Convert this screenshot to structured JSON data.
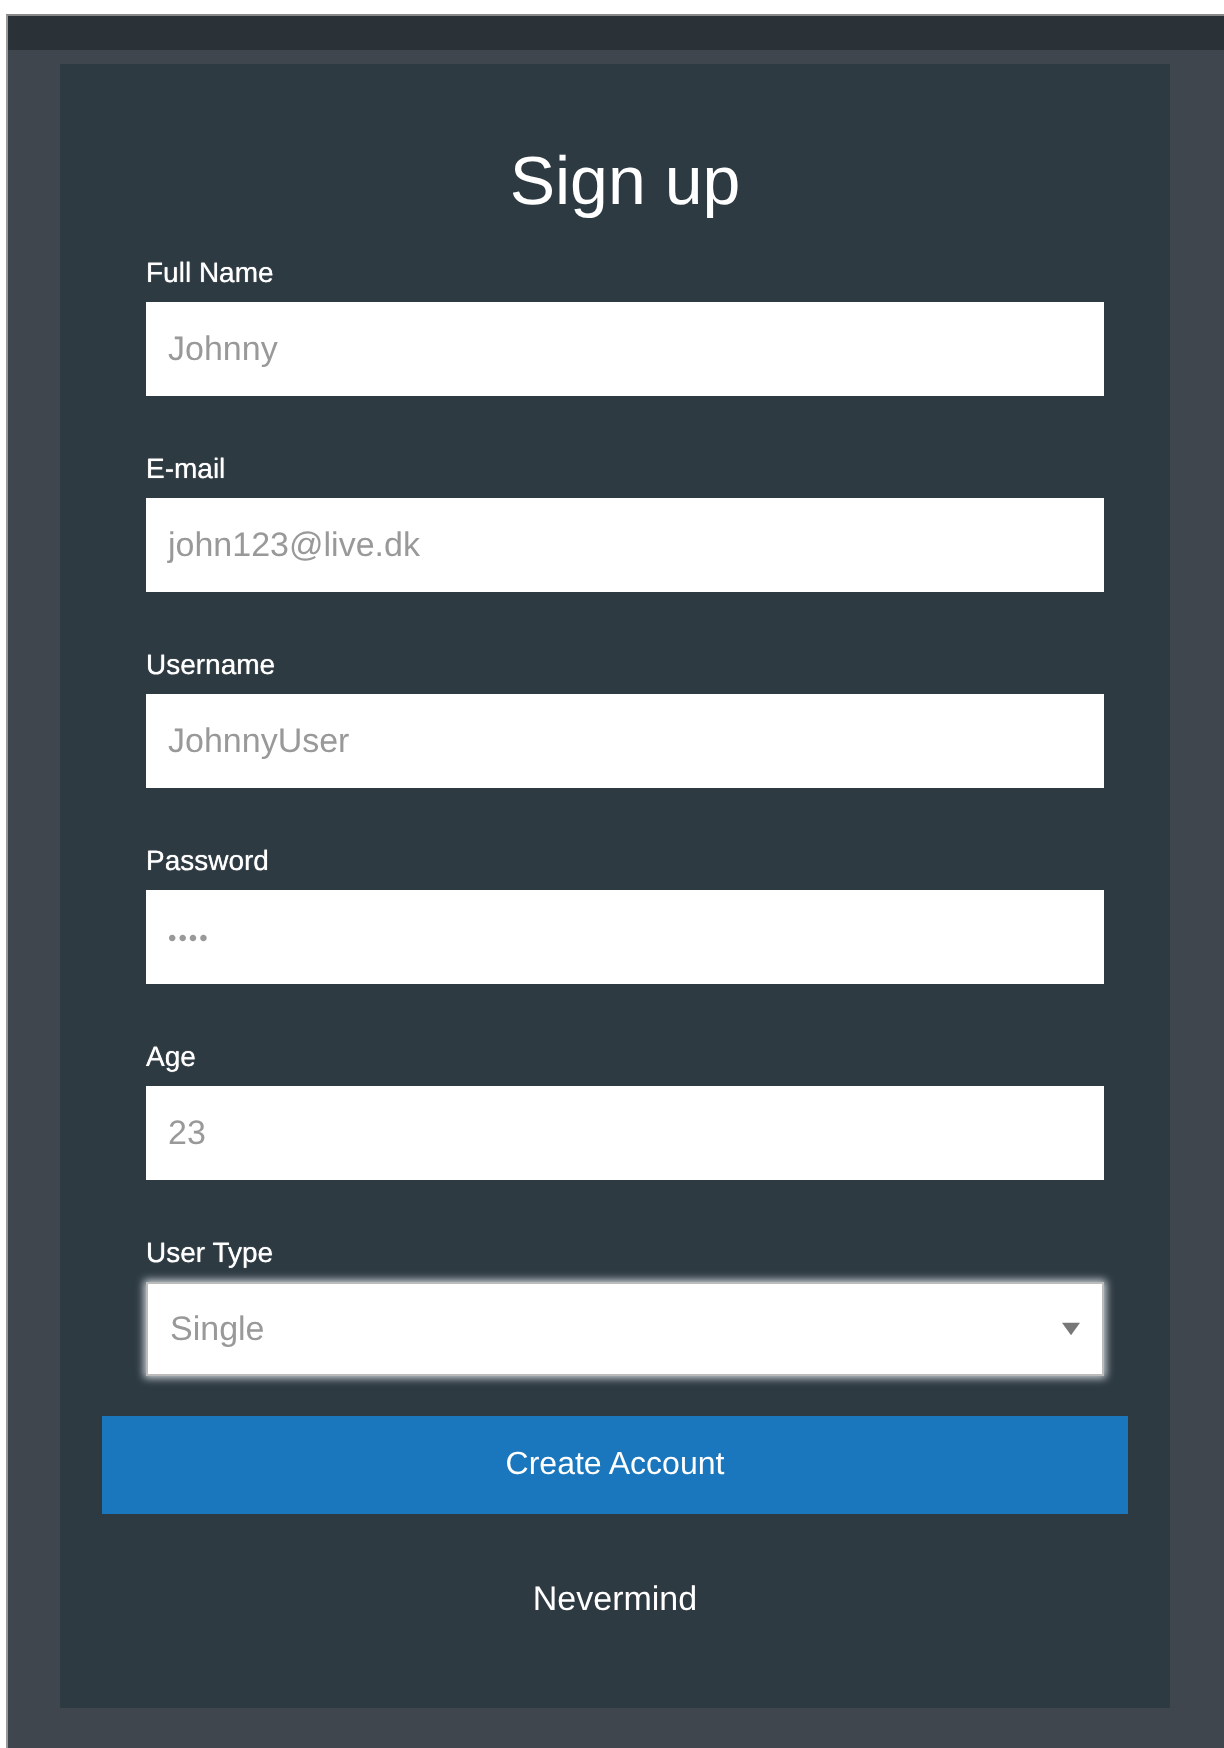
{
  "dialog": {
    "title": "Sign up",
    "fields": [
      {
        "label": "Full Name",
        "kind": "text",
        "value": "Johnny",
        "focused": false
      },
      {
        "label": "E-mail",
        "kind": "text",
        "value": "john123@live.dk",
        "focused": false
      },
      {
        "label": "Username",
        "kind": "text",
        "value": "JohnnyUser",
        "focused": false
      },
      {
        "label": "Password",
        "kind": "password",
        "value": "••••",
        "focused": false
      },
      {
        "label": "Age",
        "kind": "text",
        "value": "23",
        "focused": false
      },
      {
        "label": "User Type",
        "kind": "select",
        "value": "Single",
        "focused": true
      }
    ],
    "primary_button": "Create Account",
    "secondary_button": "Nevermind"
  }
}
